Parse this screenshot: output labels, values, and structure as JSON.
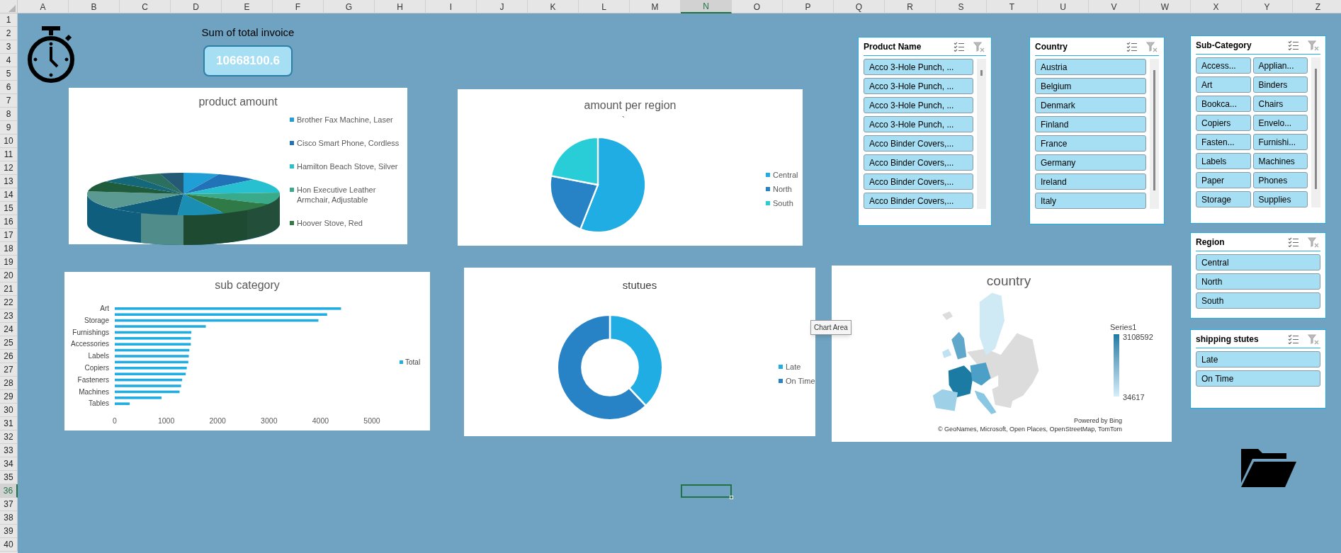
{
  "sheet": {
    "column_headers": [
      {
        "label": "A",
        "selected": false
      },
      {
        "label": "B",
        "selected": false
      },
      {
        "label": "C",
        "selected": false
      },
      {
        "label": "D",
        "selected": false
      },
      {
        "label": "E",
        "selected": false
      },
      {
        "label": "F",
        "selected": false
      },
      {
        "label": "G",
        "selected": false
      },
      {
        "label": "H",
        "selected": false
      },
      {
        "label": "I",
        "selected": false
      },
      {
        "label": "J",
        "selected": false
      },
      {
        "label": "K",
        "selected": false
      },
      {
        "label": "L",
        "selected": false
      },
      {
        "label": "M",
        "selected": false
      },
      {
        "label": "N",
        "selected": true
      },
      {
        "label": "O",
        "selected": false
      },
      {
        "label": "P",
        "selected": false
      },
      {
        "label": "Q",
        "selected": false
      },
      {
        "label": "R",
        "selected": false
      },
      {
        "label": "S",
        "selected": false
      },
      {
        "label": "T",
        "selected": false
      },
      {
        "label": "U",
        "selected": false
      },
      {
        "label": "V",
        "selected": false
      },
      {
        "label": "W",
        "selected": false
      },
      {
        "label": "X",
        "selected": false
      },
      {
        "label": "Y",
        "selected": false
      },
      {
        "label": "Z",
        "selected": false
      }
    ],
    "row_headers": [
      {
        "label": "1",
        "selected": false
      },
      {
        "label": "2",
        "selected": false
      },
      {
        "label": "3",
        "selected": false
      },
      {
        "label": "4",
        "selected": false
      },
      {
        "label": "5",
        "selected": false
      },
      {
        "label": "6",
        "selected": false
      },
      {
        "label": "7",
        "selected": false
      },
      {
        "label": "8",
        "selected": false
      },
      {
        "label": "9",
        "selected": false
      },
      {
        "label": "10",
        "selected": false
      },
      {
        "label": "11",
        "selected": false
      },
      {
        "label": "12",
        "selected": false
      },
      {
        "label": "13",
        "selected": false
      },
      {
        "label": "14",
        "selected": false
      },
      {
        "label": "15",
        "selected": false
      },
      {
        "label": "16",
        "selected": false
      },
      {
        "label": "17",
        "selected": false
      },
      {
        "label": "18",
        "selected": false
      },
      {
        "label": "19",
        "selected": false
      },
      {
        "label": "20",
        "selected": false
      },
      {
        "label": "21",
        "selected": false
      },
      {
        "label": "22",
        "selected": false
      },
      {
        "label": "23",
        "selected": false
      },
      {
        "label": "24",
        "selected": false
      },
      {
        "label": "25",
        "selected": false
      },
      {
        "label": "26",
        "selected": false
      },
      {
        "label": "27",
        "selected": false
      },
      {
        "label": "28",
        "selected": false
      },
      {
        "label": "29",
        "selected": false
      },
      {
        "label": "30",
        "selected": false
      },
      {
        "label": "31",
        "selected": false
      },
      {
        "label": "32",
        "selected": false
      },
      {
        "label": "33",
        "selected": false
      },
      {
        "label": "34",
        "selected": false
      },
      {
        "label": "35",
        "selected": false
      },
      {
        "label": "36",
        "selected": true
      },
      {
        "label": "37",
        "selected": false
      },
      {
        "label": "38",
        "selected": false
      },
      {
        "label": "39",
        "selected": false
      },
      {
        "label": "40",
        "selected": false
      }
    ]
  },
  "kpi": {
    "label": "Sum of total invoice",
    "value": "10668100.6"
  },
  "product_chart": {
    "title": "product amount",
    "legend": [
      {
        "label": "Brother Fax Machine, Laser",
        "color": "#1f9fd6"
      },
      {
        "label": "Cisco Smart Phone, Cordless",
        "color": "#2272b8"
      },
      {
        "label": "Hamilton Beach Stove, Silver",
        "color": "#27c0d0"
      },
      {
        "label": "Hon Executive Leather Armchair, Adjustable",
        "color": "#3aab8a"
      },
      {
        "label": "Hoover Stove, Red",
        "color": "#2f7a46"
      }
    ]
  },
  "region_chart": {
    "title": "amount per region",
    "title_note": "`",
    "legend": [
      {
        "label": "Central",
        "color": "#1fade3"
      },
      {
        "label": "North",
        "color": "#2783c6"
      },
      {
        "label": "South",
        "color": "#28cdd8"
      }
    ]
  },
  "subcategory_chart": {
    "title": "sub category",
    "chart_data": {
      "type": "bar",
      "orientation": "horizontal",
      "xlim": [
        0,
        5000
      ],
      "categories": [
        "Art",
        null,
        "Storage",
        null,
        "Furnishings",
        null,
        "Accessories",
        null,
        "Labels",
        null,
        "Copiers",
        null,
        "Fasteners",
        null,
        "Machines",
        null,
        "Tables"
      ],
      "xticks": [
        0,
        1000,
        2000,
        3000,
        4000,
        5000
      ],
      "series": [
        {
          "name": "Total",
          "color": "#1fade3",
          "values": [
            4400,
            4130,
            3960,
            1770,
            1490,
            1480,
            1480,
            1450,
            1440,
            1430,
            1400,
            1380,
            1310,
            1290,
            1260,
            910,
            290
          ]
        }
      ]
    }
  },
  "status_chart": {
    "title": "stutues",
    "legend": [
      {
        "label": "Late",
        "color": "#1fade3"
      },
      {
        "label": "On Time",
        "color": "#2783c6"
      }
    ]
  },
  "tooltip": "Chart Area",
  "map_chart": {
    "title": "country",
    "legend_title": "Series1",
    "legend_max": "3108592",
    "legend_min": "34617",
    "credit": "Powered by Bing",
    "attribution": "© GeoNames, Microsoft, Open Places, OpenStreetMap, TomTom"
  },
  "slicers": [
    {
      "title": "Product Name",
      "kind": "list",
      "scrollable": true,
      "items": [
        {
          "label": "Acco 3-Hole Punch, ...",
          "selected": true
        },
        {
          "label": "Acco 3-Hole Punch, ...",
          "selected": true
        },
        {
          "label": "Acco 3-Hole Punch, ...",
          "selected": true
        },
        {
          "label": "Acco 3-Hole Punch, ...",
          "selected": true
        },
        {
          "label": "Acco Binder Covers,...",
          "selected": true
        },
        {
          "label": "Acco Binder Covers,...",
          "selected": true
        },
        {
          "label": "Acco Binder Covers,...",
          "selected": true
        },
        {
          "label": "Acco Binder Covers,...",
          "selected": true
        }
      ]
    },
    {
      "title": "Country",
      "kind": "list",
      "scrollable": true,
      "items": [
        {
          "label": "Austria",
          "selected": true
        },
        {
          "label": "Belgium",
          "selected": true
        },
        {
          "label": "Denmark",
          "selected": true
        },
        {
          "label": "Finland",
          "selected": true
        },
        {
          "label": "France",
          "selected": true
        },
        {
          "label": "Germany",
          "selected": true
        },
        {
          "label": "Ireland",
          "selected": true
        },
        {
          "label": "Italy",
          "selected": true
        }
      ]
    },
    {
      "title": "Sub-Category",
      "kind": "grid",
      "scrollable": true,
      "items": [
        {
          "label": "Access...",
          "selected": true
        },
        {
          "label": "Applian...",
          "selected": true
        },
        {
          "label": "Art",
          "selected": true
        },
        {
          "label": "Binders",
          "selected": true
        },
        {
          "label": "Bookca...",
          "selected": true
        },
        {
          "label": "Chairs",
          "selected": true
        },
        {
          "label": "Copiers",
          "selected": true
        },
        {
          "label": "Envelo...",
          "selected": true
        },
        {
          "label": "Fasten...",
          "selected": true
        },
        {
          "label": "Furnishi...",
          "selected": true
        },
        {
          "label": "Labels",
          "selected": true
        },
        {
          "label": "Machines",
          "selected": true
        },
        {
          "label": "Paper",
          "selected": true
        },
        {
          "label": "Phones",
          "selected": true
        },
        {
          "label": "Storage",
          "selected": true
        },
        {
          "label": "Supplies",
          "selected": true
        }
      ]
    },
    {
      "title": "Region",
      "kind": "list",
      "scrollable": false,
      "items": [
        {
          "label": "Central",
          "selected": true
        },
        {
          "label": "North",
          "selected": true
        },
        {
          "label": "South",
          "selected": true
        }
      ]
    },
    {
      "title": "shipping stutes",
      "kind": "list",
      "scrollable": false,
      "items": [
        {
          "label": "Late",
          "selected": true
        },
        {
          "label": "On Time",
          "selected": true
        }
      ]
    }
  ]
}
